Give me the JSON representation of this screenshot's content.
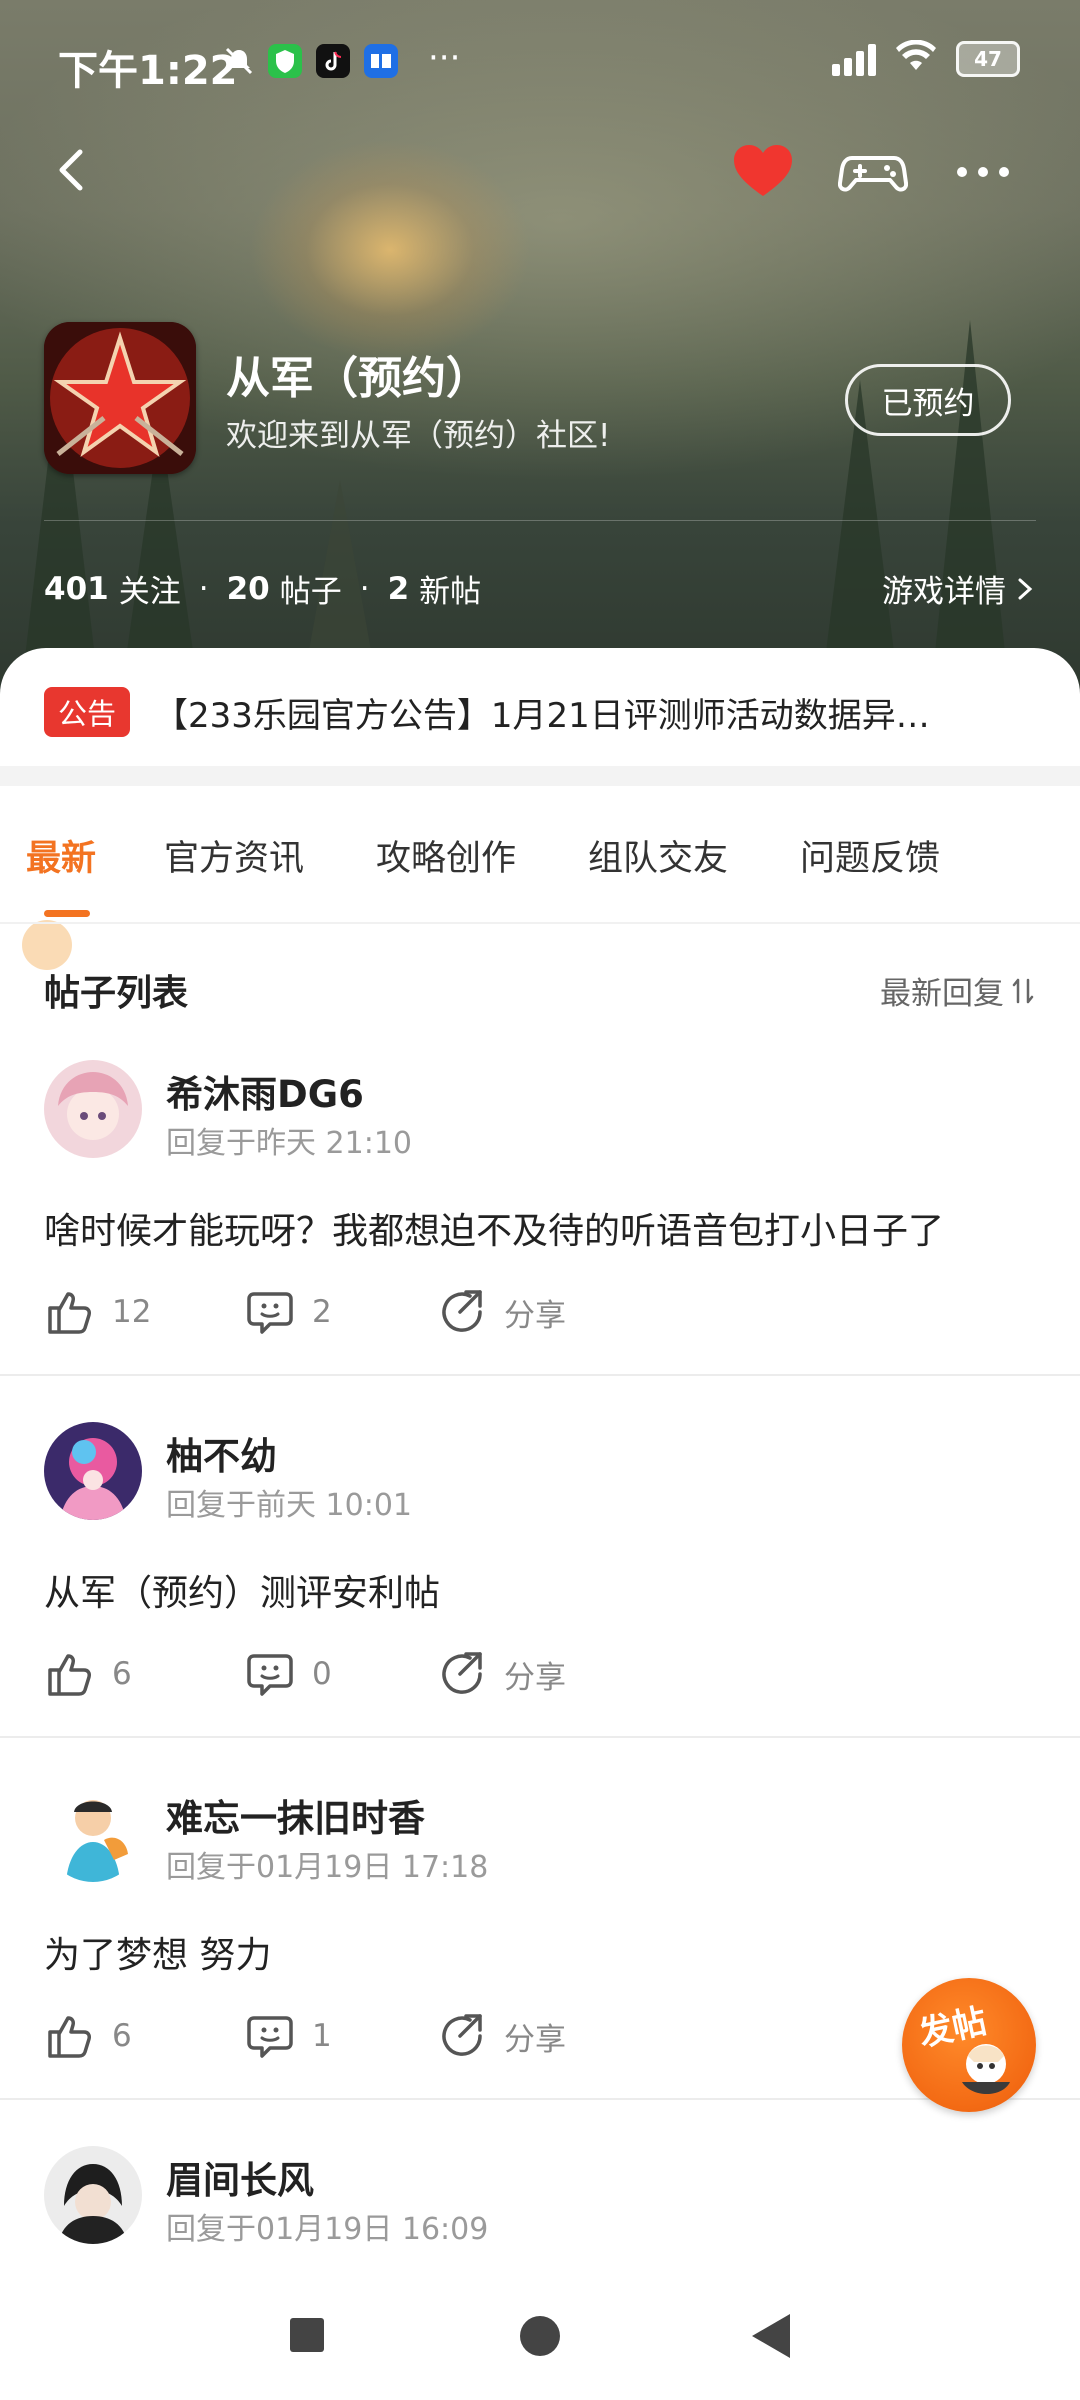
{
  "status_bar": {
    "time": "下午1:22",
    "battery": "47",
    "icons": [
      "mute-icon",
      "shield-app-icon",
      "tiktok-app-icon",
      "zhihu-app-icon",
      "more-dots-icon",
      "signal-icon",
      "wifi-icon",
      "battery-icon"
    ]
  },
  "game": {
    "title": "从军（预约）",
    "subtitle": "欢迎来到从军（预约）社区!",
    "reserve_label": "已预约",
    "stats": {
      "followers": "401",
      "followers_label": "关注",
      "posts": "20",
      "posts_label": "帖子",
      "new_posts": "2",
      "new_posts_label": "新帖",
      "separator": "·"
    },
    "detail_label": "游戏详情"
  },
  "notice": {
    "badge": "公告",
    "text": "【233乐园官方公告】1月21日评测师活动数据异…"
  },
  "tabs": [
    {
      "label": "最新",
      "active": true
    },
    {
      "label": "官方资讯",
      "active": false
    },
    {
      "label": "攻略创作",
      "active": false
    },
    {
      "label": "组队交友",
      "active": false
    },
    {
      "label": "问题反馈",
      "active": false
    }
  ],
  "list": {
    "title": "帖子列表",
    "sort_label": "最新回复"
  },
  "posts": [
    {
      "author": "希沐雨DG6",
      "reply_time": "回复于昨天 21:10",
      "content": "啥时候才能玩呀？我都想迫不及待的听语音包打小日子了",
      "likes": "12",
      "comments": "2",
      "share": "分享"
    },
    {
      "author": "柚不幼",
      "reply_time": "回复于前天 10:01",
      "content": "从军（预约）测评安利帖",
      "likes": "6",
      "comments": "0",
      "share": "分享"
    },
    {
      "author": "难忘一抹旧时香",
      "reply_time": "回复于01月19日 17:18",
      "content": "为了梦想 努力",
      "likes": "6",
      "comments": "1",
      "share": "分享"
    },
    {
      "author": "眉间长风",
      "reply_time": "回复于01月19日 16:09",
      "content": "",
      "likes": "",
      "comments": "",
      "share": ""
    }
  ],
  "fab": {
    "label": "发帖"
  },
  "colors": {
    "accent": "#f37321",
    "notice_red": "#e8372f",
    "heart": "#f0362f"
  }
}
